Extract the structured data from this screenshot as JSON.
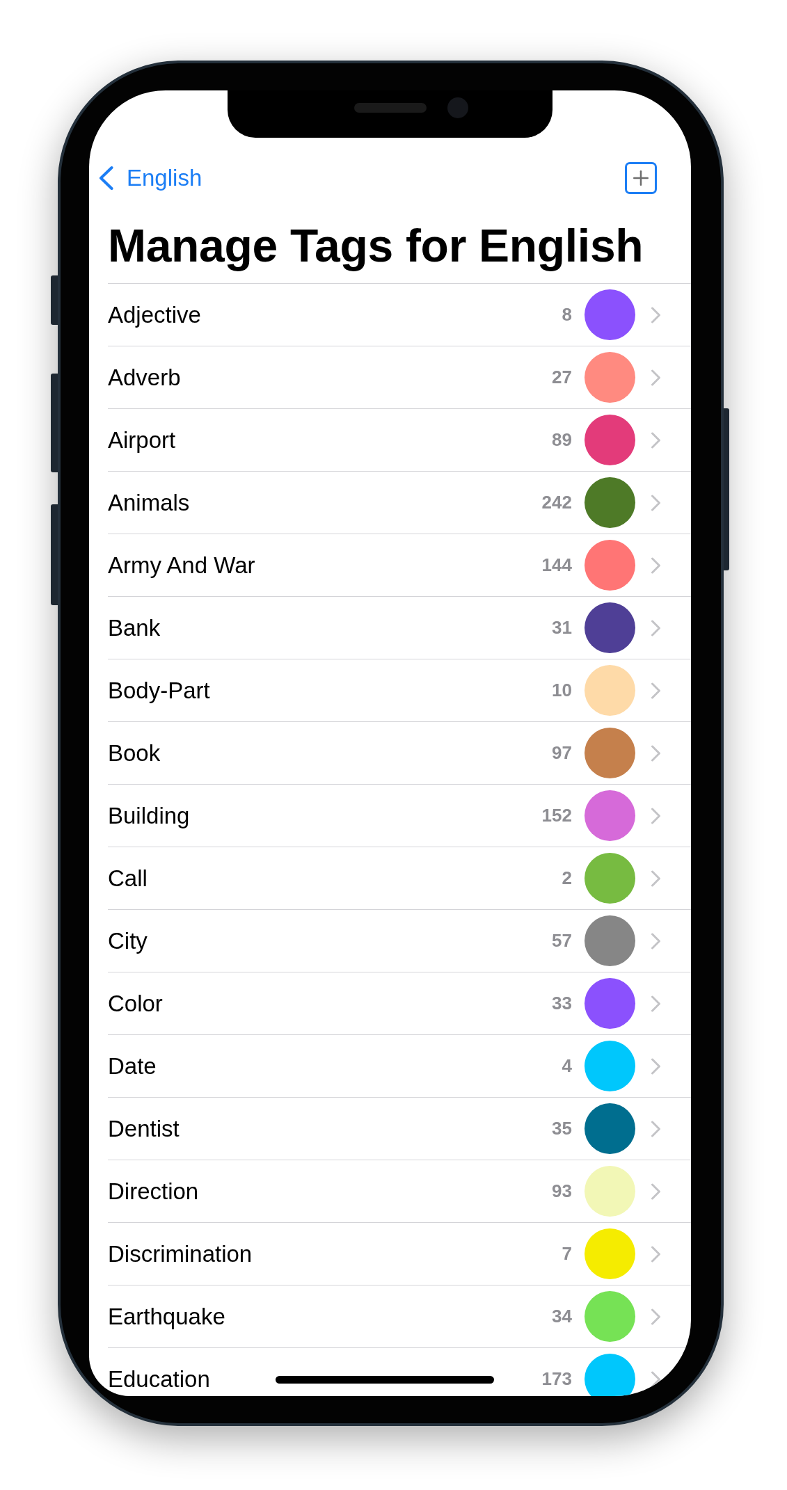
{
  "nav": {
    "back_label": "English"
  },
  "title": "Manage Tags for English",
  "tags": [
    {
      "name": "Adjective",
      "count": "8",
      "color": "#8b51fd"
    },
    {
      "name": "Adverb",
      "count": "27",
      "color": "#ff8a80"
    },
    {
      "name": "Airport",
      "count": "89",
      "color": "#e33b7a"
    },
    {
      "name": "Animals",
      "count": "242",
      "color": "#4e7a27"
    },
    {
      "name": "Army And War",
      "count": "144",
      "color": "#ff7575"
    },
    {
      "name": "Bank",
      "count": "31",
      "color": "#4f3f96"
    },
    {
      "name": "Body-Part",
      "count": "10",
      "color": "#fedaa8"
    },
    {
      "name": "Book",
      "count": "97",
      "color": "#c5804c"
    },
    {
      "name": "Building",
      "count": "152",
      "color": "#d66ad9"
    },
    {
      "name": "Call",
      "count": "2",
      "color": "#77bb41"
    },
    {
      "name": "City",
      "count": "57",
      "color": "#868686"
    },
    {
      "name": "Color",
      "count": "33",
      "color": "#8b51fd"
    },
    {
      "name": "Date",
      "count": "4",
      "color": "#00c7fc"
    },
    {
      "name": "Dentist",
      "count": "35",
      "color": "#006e8f"
    },
    {
      "name": "Direction",
      "count": "93",
      "color": "#f2f7b6"
    },
    {
      "name": "Discrimination",
      "count": "7",
      "color": "#f5ec00"
    },
    {
      "name": "Earthquake",
      "count": "34",
      "color": "#76e255"
    },
    {
      "name": "Education",
      "count": "173",
      "color": "#00c7fc"
    }
  ]
}
